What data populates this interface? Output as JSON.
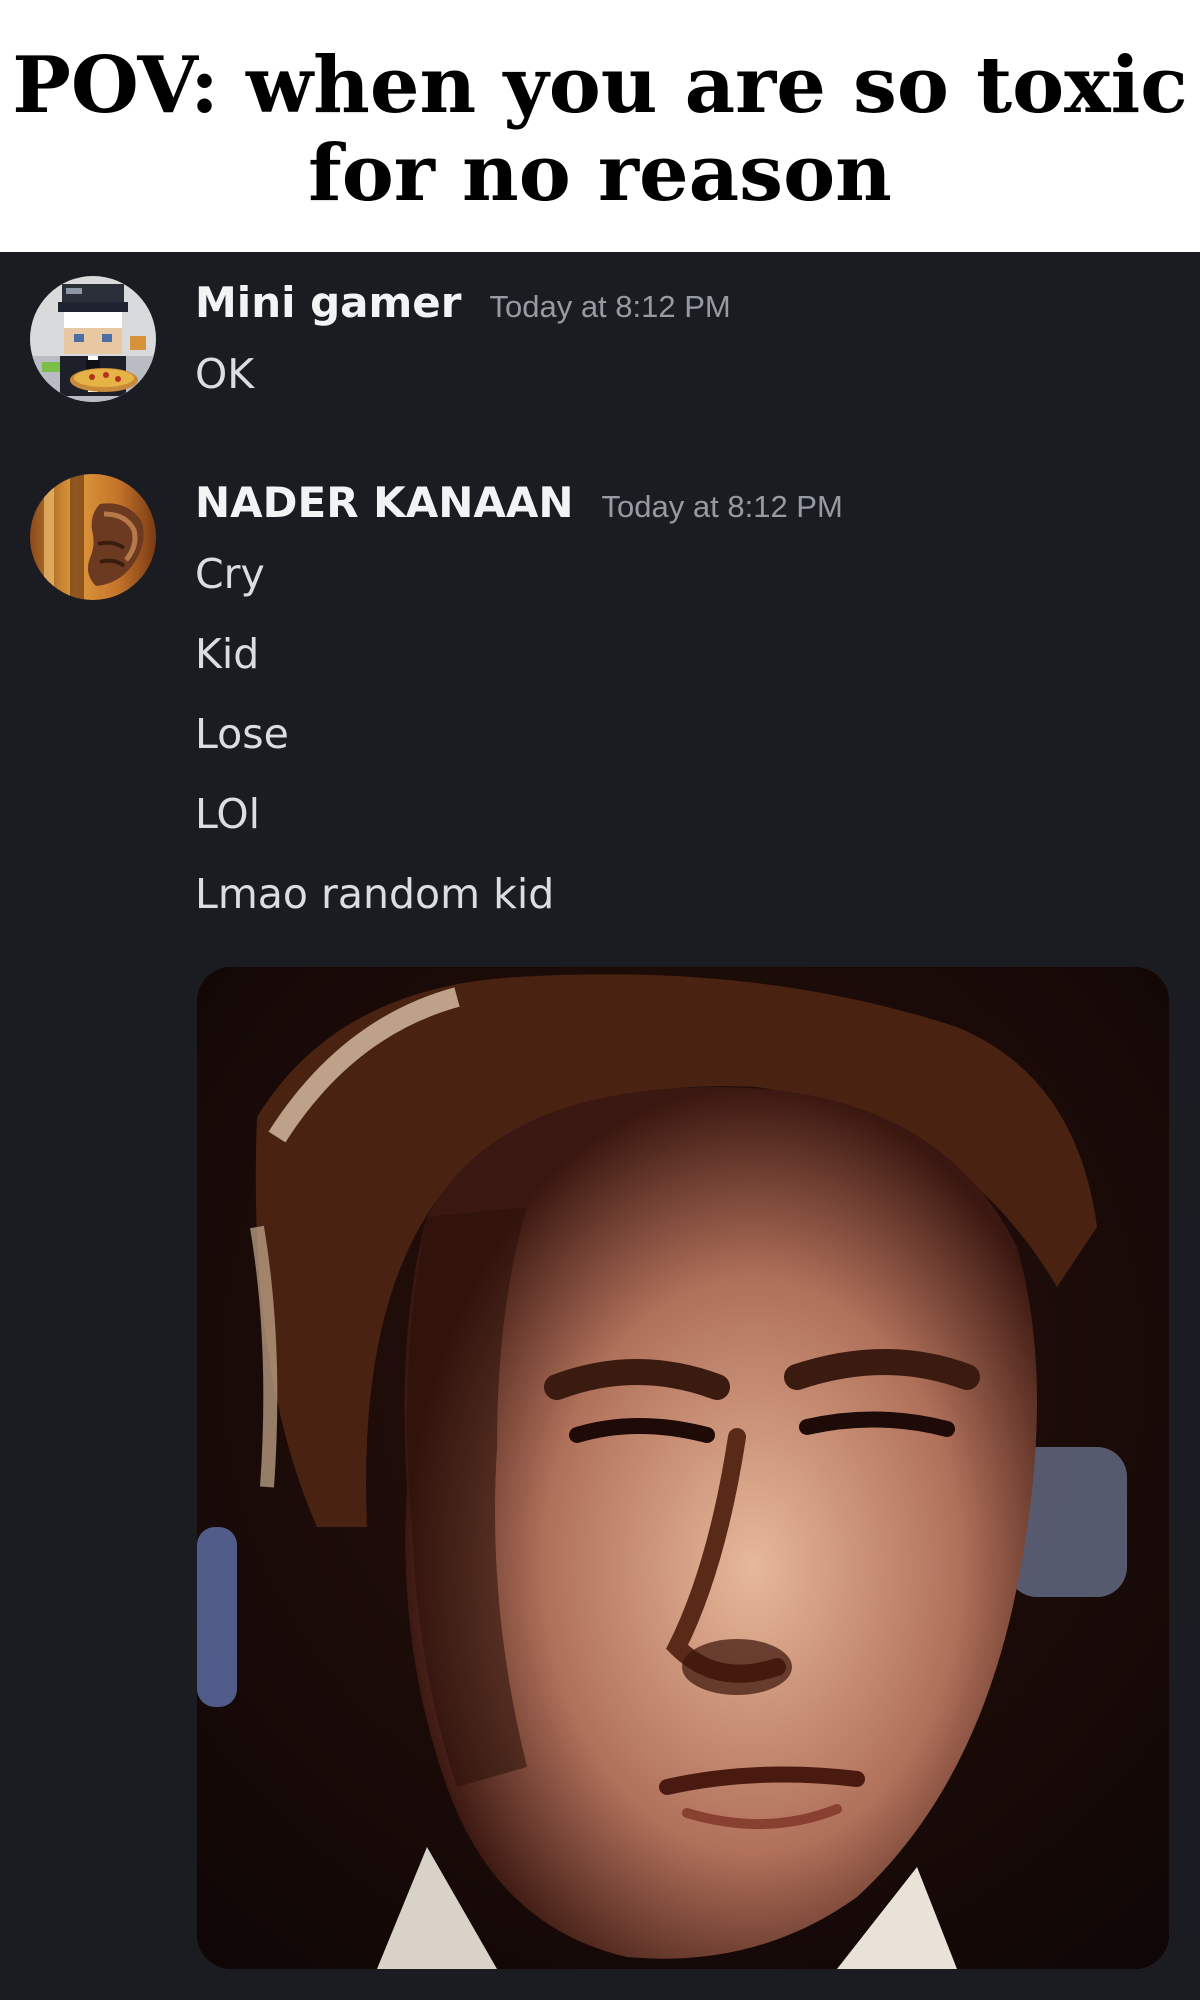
{
  "meme": {
    "caption": "POV: when you are so toxic for no reason"
  },
  "chat": {
    "background": "#1b1c21",
    "messages": [
      {
        "username": "Mini gamer",
        "timestamp": "Today at 8:12 PM",
        "lines": [
          "OK"
        ],
        "avatar": "minecraft-pizza-avatar"
      },
      {
        "username": "NADER KANAAN",
        "timestamp": "Today at 8:12 PM",
        "lines": [
          "Cry",
          "Kid",
          "Lose",
          "LOl",
          "Lmao random kid"
        ],
        "avatar": "armored-hand-avatar",
        "attachment": "reaction-gif-squinting-man"
      }
    ]
  }
}
